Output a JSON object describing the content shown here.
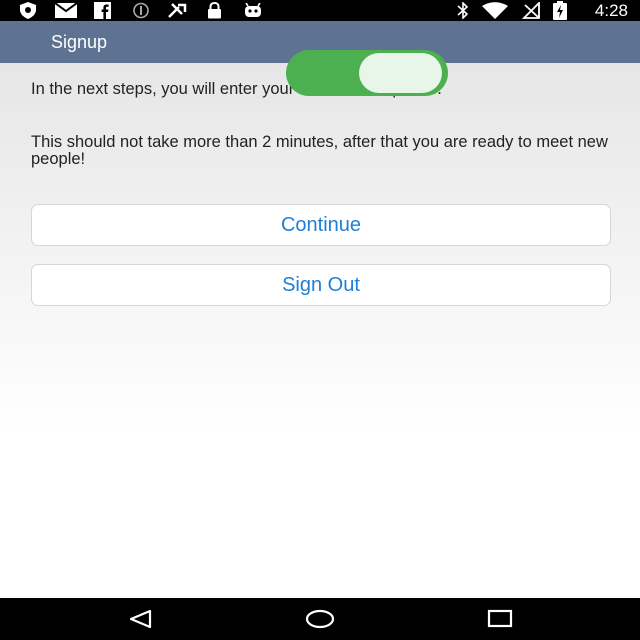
{
  "status_bar": {
    "time": "4:28",
    "icons": [
      "shield-icon",
      "email-icon",
      "facebook-icon",
      "no-sim-icon",
      "tools-icon",
      "lock-icon",
      "android-icon",
      "bluetooth-icon",
      "wifi-icon",
      "no-signal-icon",
      "battery-charging-icon"
    ]
  },
  "app_bar": {
    "title": "Signup"
  },
  "main": {
    "intro_text": "In the next steps, you will enter your BuzzMuslim profile.",
    "duration_text": "This should not take more than 2 minutes, after that you are ready to meet new people!",
    "continue_label": "Continue",
    "signout_label": "Sign Out"
  },
  "toggle": {
    "state": "on",
    "track_color": "#4cb050"
  },
  "nav_bar": {
    "icons": [
      "back-icon",
      "home-icon",
      "recents-icon"
    ]
  },
  "colors": {
    "app_bar": "#5e7391",
    "button_text": "#1f7fd6"
  }
}
